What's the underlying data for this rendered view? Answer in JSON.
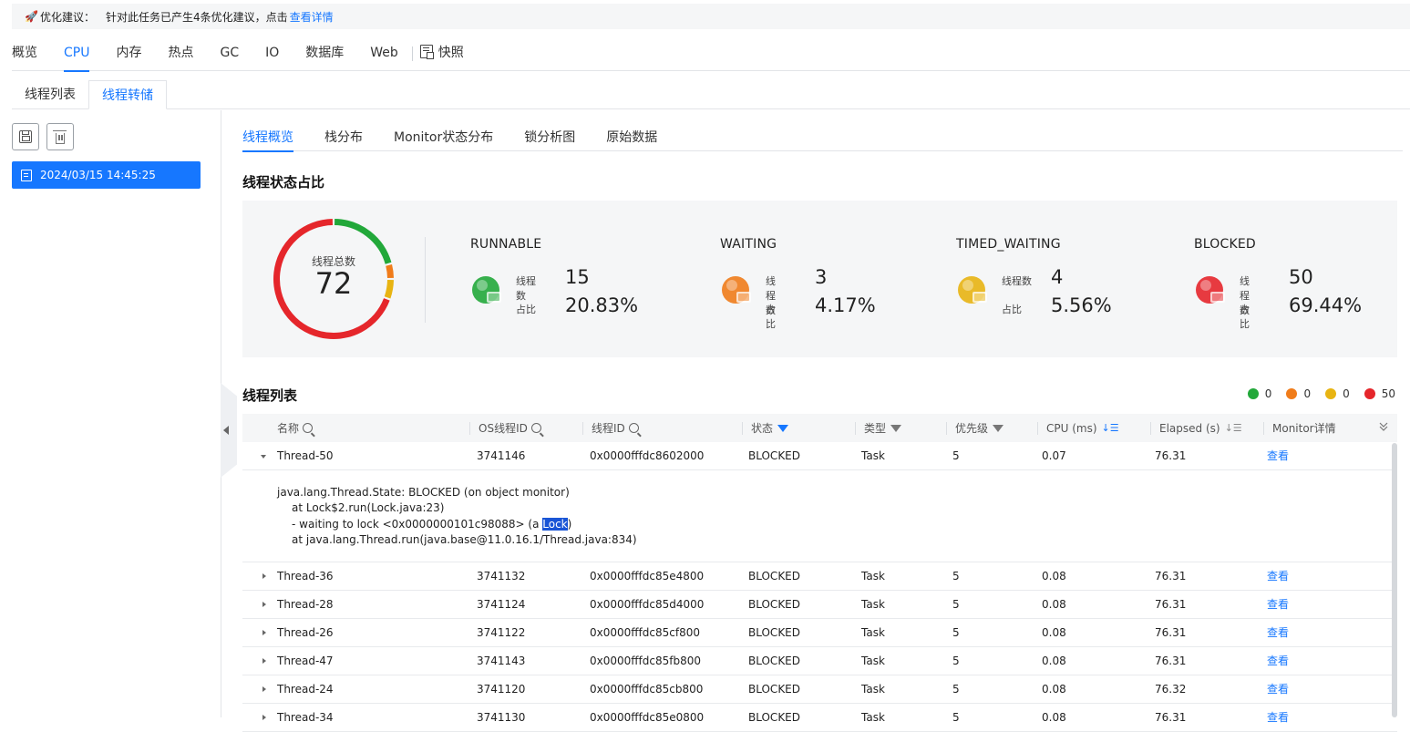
{
  "banner": {
    "label": "优化建议：",
    "text": "针对此任务已产生4条优化建议，点击",
    "link": "查看详情"
  },
  "top_tabs": [
    "概览",
    "CPU",
    "内存",
    "热点",
    "GC",
    "IO",
    "数据库",
    "Web"
  ],
  "top_tabs_active": "CPU",
  "snapshot_label": "快照",
  "sub_tabs": [
    "线程列表",
    "线程转储"
  ],
  "sub_tabs_active": "线程转储",
  "left_panel": {
    "dump_timestamp": "2024/03/15 14:45:25"
  },
  "analysis_tabs": [
    "线程概览",
    "栈分布",
    "Monitor状态分布",
    "锁分析图",
    "原始数据"
  ],
  "analysis_tabs_active": "线程概览",
  "status_section": {
    "title": "线程状态占比",
    "total_label": "线程总数",
    "total": "72",
    "count_label": "线程数",
    "ratio_label": "占比",
    "states": [
      {
        "name": "RUNNABLE",
        "count": "15",
        "ratio": "20.83%",
        "color": "#22a83a"
      },
      {
        "name": "WAITING",
        "count": "3",
        "ratio": "4.17%",
        "color": "#f07c1a"
      },
      {
        "name": "TIMED_WAITING",
        "count": "4",
        "ratio": "5.56%",
        "color": "#e8b412"
      },
      {
        "name": "BLOCKED",
        "count": "50",
        "ratio": "69.44%",
        "color": "#e5262b"
      }
    ]
  },
  "thread_list": {
    "title": "线程列表",
    "legend": [
      {
        "color": "#22a83a",
        "value": "0"
      },
      {
        "color": "#f07c1a",
        "value": "0"
      },
      {
        "color": "#e8b412",
        "value": "0"
      },
      {
        "color": "#e5262b",
        "value": "50"
      }
    ],
    "columns": {
      "name": "名称",
      "os_id": "OS线程ID",
      "thread_id": "线程ID",
      "state": "状态",
      "type": "类型",
      "priority": "优先级",
      "cpu": "CPU (ms)",
      "elapsed": "Elapsed (s)",
      "monitor": "Monitor详情"
    },
    "view_label": "查看",
    "stack": {
      "line1": "java.lang.Thread.State: BLOCKED (on object monitor)",
      "line2": "at Lock$2.run(Lock.java:23)",
      "line3_prefix": "- waiting to lock <0x0000000101c98088> (a ",
      "line3_highlight": "Lock",
      "line3_suffix": ")",
      "line4": "at java.lang.Thread.run(java.base@11.0.16.1/Thread.java:834)"
    },
    "rows": [
      {
        "name": "Thread-50",
        "os_id": "3741146",
        "thread_id": "0x0000fffdc8602000",
        "state": "BLOCKED",
        "type": "Task",
        "priority": "5",
        "cpu": "0.07",
        "elapsed": "76.31"
      },
      {
        "name": "Thread-36",
        "os_id": "3741132",
        "thread_id": "0x0000fffdc85e4800",
        "state": "BLOCKED",
        "type": "Task",
        "priority": "5",
        "cpu": "0.08",
        "elapsed": "76.31"
      },
      {
        "name": "Thread-28",
        "os_id": "3741124",
        "thread_id": "0x0000fffdc85d4000",
        "state": "BLOCKED",
        "type": "Task",
        "priority": "5",
        "cpu": "0.08",
        "elapsed": "76.31"
      },
      {
        "name": "Thread-26",
        "os_id": "3741122",
        "thread_id": "0x0000fffdc85cf800",
        "state": "BLOCKED",
        "type": "Task",
        "priority": "5",
        "cpu": "0.08",
        "elapsed": "76.31"
      },
      {
        "name": "Thread-47",
        "os_id": "3741143",
        "thread_id": "0x0000fffdc85fb800",
        "state": "BLOCKED",
        "type": "Task",
        "priority": "5",
        "cpu": "0.08",
        "elapsed": "76.31"
      },
      {
        "name": "Thread-24",
        "os_id": "3741120",
        "thread_id": "0x0000fffdc85cb800",
        "state": "BLOCKED",
        "type": "Task",
        "priority": "5",
        "cpu": "0.08",
        "elapsed": "76.32"
      },
      {
        "name": "Thread-34",
        "os_id": "3741130",
        "thread_id": "0x0000fffdc85e0800",
        "state": "BLOCKED",
        "type": "Task",
        "priority": "5",
        "cpu": "0.08",
        "elapsed": "76.31"
      }
    ]
  }
}
